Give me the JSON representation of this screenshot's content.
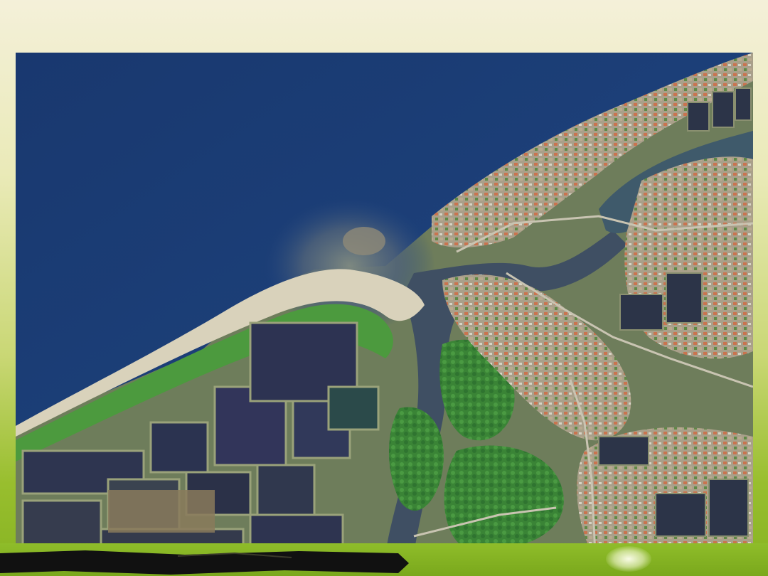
{
  "slide": {
    "background_colors": [
      "#f4f0d9",
      "#eaeab8",
      "#c9d774",
      "#98be2e",
      "#86b322"
    ],
    "bottom_band_color": "#7aa81c",
    "brush_stroke_color": "#111111"
  },
  "photo": {
    "subject": "satellite-image-river-estuary",
    "colors": {
      "sea": "#1b3d78",
      "sediment_plume": "#6b7a86",
      "sand": "#d9d2bb",
      "ponds": "#2e3550",
      "vegetation": "#3f8a3a",
      "urban": "#b8a48e",
      "river": "#3f4f63"
    }
  }
}
